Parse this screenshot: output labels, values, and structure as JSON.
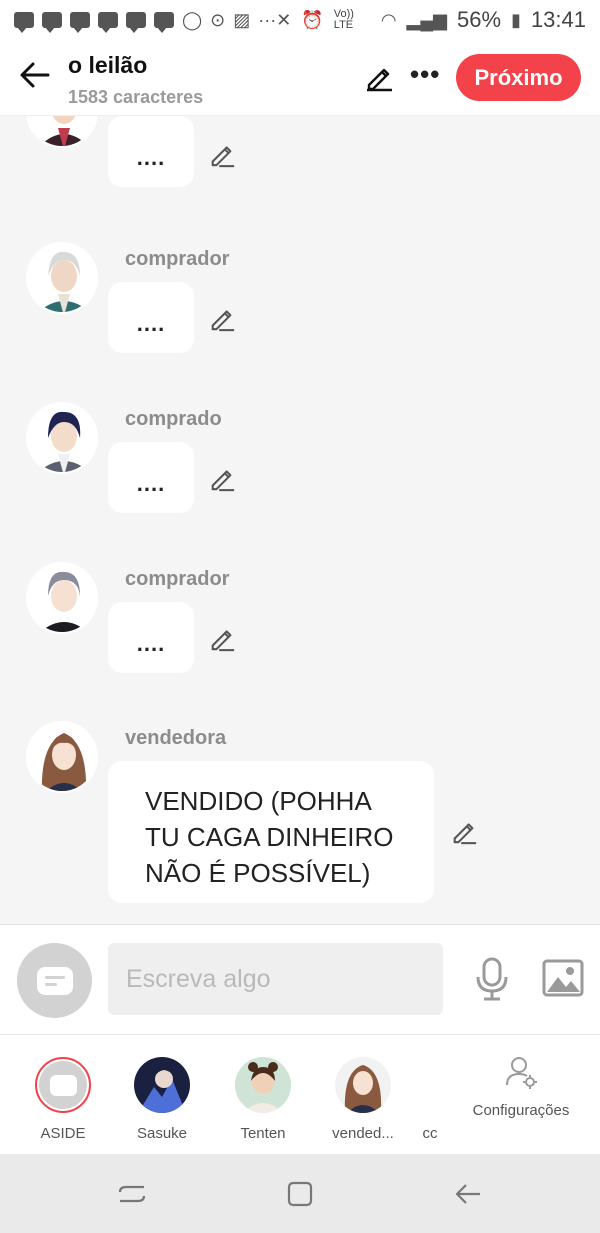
{
  "status_bar": {
    "battery": "56%",
    "time": "13:41",
    "volte": "Vo)) LTE"
  },
  "header": {
    "title": "o leilão",
    "subtitle": "1583 caracteres",
    "next_label": "Próximo"
  },
  "messages": [
    {
      "name": "",
      "text": "...."
    },
    {
      "name": "comprador",
      "text": "...."
    },
    {
      "name": "comprado",
      "text": "...."
    },
    {
      "name": "comprador",
      "text": "...."
    },
    {
      "name": "vendedora",
      "text": "VENDIDO (POHHA TU CAGA DINHEIRO NÃO É POSSÍVEL)"
    }
  ],
  "composer": {
    "placeholder": "Escreva algo"
  },
  "characters": [
    {
      "label": "ASIDE"
    },
    {
      "label": "Sasuke"
    },
    {
      "label": "Tenten"
    },
    {
      "label": "vended..."
    },
    {
      "label": "cc"
    }
  ],
  "settings_label": "Configurações",
  "colors": {
    "accent": "#f4424b",
    "bubble": "#ffffff",
    "background": "#f5f5f5",
    "name_gray": "#8c8c8c"
  }
}
